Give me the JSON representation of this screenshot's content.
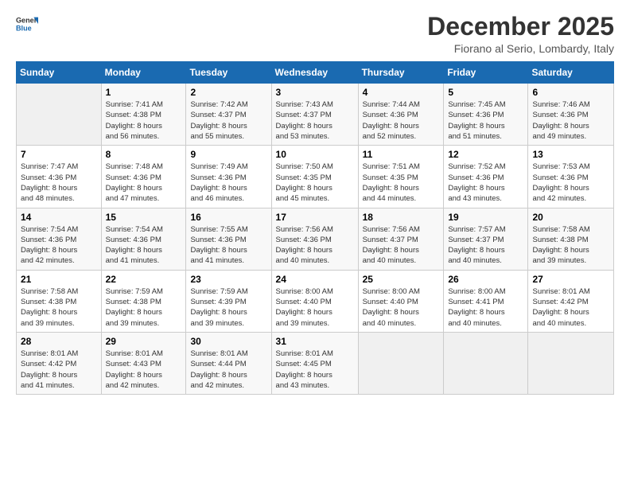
{
  "header": {
    "title": "December 2025",
    "subtitle": "Fiorano al Serio, Lombardy, Italy"
  },
  "weekdays": [
    "Sunday",
    "Monday",
    "Tuesday",
    "Wednesday",
    "Thursday",
    "Friday",
    "Saturday"
  ],
  "days": [
    {
      "date": "",
      "sunrise": "",
      "sunset": "",
      "daylight": ""
    },
    {
      "date": "1",
      "sunrise": "7:41 AM",
      "sunset": "4:38 PM",
      "daylight": "8 hours and 56 minutes."
    },
    {
      "date": "2",
      "sunrise": "7:42 AM",
      "sunset": "4:37 PM",
      "daylight": "8 hours and 55 minutes."
    },
    {
      "date": "3",
      "sunrise": "7:43 AM",
      "sunset": "4:37 PM",
      "daylight": "8 hours and 53 minutes."
    },
    {
      "date": "4",
      "sunrise": "7:44 AM",
      "sunset": "4:36 PM",
      "daylight": "8 hours and 52 minutes."
    },
    {
      "date": "5",
      "sunrise": "7:45 AM",
      "sunset": "4:36 PM",
      "daylight": "8 hours and 51 minutes."
    },
    {
      "date": "6",
      "sunrise": "7:46 AM",
      "sunset": "4:36 PM",
      "daylight": "8 hours and 49 minutes."
    },
    {
      "date": "7",
      "sunrise": "7:47 AM",
      "sunset": "4:36 PM",
      "daylight": "8 hours and 48 minutes."
    },
    {
      "date": "8",
      "sunrise": "7:48 AM",
      "sunset": "4:36 PM",
      "daylight": "8 hours and 47 minutes."
    },
    {
      "date": "9",
      "sunrise": "7:49 AM",
      "sunset": "4:36 PM",
      "daylight": "8 hours and 46 minutes."
    },
    {
      "date": "10",
      "sunrise": "7:50 AM",
      "sunset": "4:35 PM",
      "daylight": "8 hours and 45 minutes."
    },
    {
      "date": "11",
      "sunrise": "7:51 AM",
      "sunset": "4:35 PM",
      "daylight": "8 hours and 44 minutes."
    },
    {
      "date": "12",
      "sunrise": "7:52 AM",
      "sunset": "4:36 PM",
      "daylight": "8 hours and 43 minutes."
    },
    {
      "date": "13",
      "sunrise": "7:53 AM",
      "sunset": "4:36 PM",
      "daylight": "8 hours and 42 minutes."
    },
    {
      "date": "14",
      "sunrise": "7:54 AM",
      "sunset": "4:36 PM",
      "daylight": "8 hours and 42 minutes."
    },
    {
      "date": "15",
      "sunrise": "7:54 AM",
      "sunset": "4:36 PM",
      "daylight": "8 hours and 41 minutes."
    },
    {
      "date": "16",
      "sunrise": "7:55 AM",
      "sunset": "4:36 PM",
      "daylight": "8 hours and 41 minutes."
    },
    {
      "date": "17",
      "sunrise": "7:56 AM",
      "sunset": "4:36 PM",
      "daylight": "8 hours and 40 minutes."
    },
    {
      "date": "18",
      "sunrise": "7:56 AM",
      "sunset": "4:37 PM",
      "daylight": "8 hours and 40 minutes."
    },
    {
      "date": "19",
      "sunrise": "7:57 AM",
      "sunset": "4:37 PM",
      "daylight": "8 hours and 40 minutes."
    },
    {
      "date": "20",
      "sunrise": "7:58 AM",
      "sunset": "4:38 PM",
      "daylight": "8 hours and 39 minutes."
    },
    {
      "date": "21",
      "sunrise": "7:58 AM",
      "sunset": "4:38 PM",
      "daylight": "8 hours and 39 minutes."
    },
    {
      "date": "22",
      "sunrise": "7:59 AM",
      "sunset": "4:38 PM",
      "daylight": "8 hours and 39 minutes."
    },
    {
      "date": "23",
      "sunrise": "7:59 AM",
      "sunset": "4:39 PM",
      "daylight": "8 hours and 39 minutes."
    },
    {
      "date": "24",
      "sunrise": "8:00 AM",
      "sunset": "4:40 PM",
      "daylight": "8 hours and 39 minutes."
    },
    {
      "date": "25",
      "sunrise": "8:00 AM",
      "sunset": "4:40 PM",
      "daylight": "8 hours and 40 minutes."
    },
    {
      "date": "26",
      "sunrise": "8:00 AM",
      "sunset": "4:41 PM",
      "daylight": "8 hours and 40 minutes."
    },
    {
      "date": "27",
      "sunrise": "8:01 AM",
      "sunset": "4:42 PM",
      "daylight": "8 hours and 40 minutes."
    },
    {
      "date": "28",
      "sunrise": "8:01 AM",
      "sunset": "4:42 PM",
      "daylight": "8 hours and 41 minutes."
    },
    {
      "date": "29",
      "sunrise": "8:01 AM",
      "sunset": "4:43 PM",
      "daylight": "8 hours and 42 minutes."
    },
    {
      "date": "30",
      "sunrise": "8:01 AM",
      "sunset": "4:44 PM",
      "daylight": "8 hours and 42 minutes."
    },
    {
      "date": "31",
      "sunrise": "8:01 AM",
      "sunset": "4:45 PM",
      "daylight": "8 hours and 43 minutes."
    }
  ]
}
